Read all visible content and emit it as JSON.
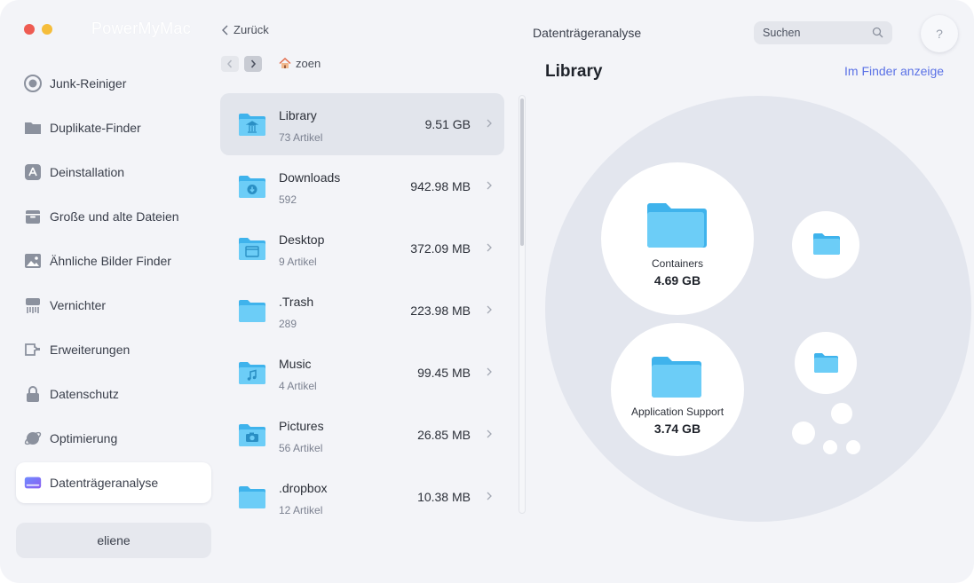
{
  "app": {
    "title": "PowerMyMac"
  },
  "sidebar": {
    "items": [
      {
        "label": "Junk-Reiniger",
        "icon": "junk-cleaner-icon"
      },
      {
        "label": "Duplikate-Finder",
        "icon": "duplicate-folder-icon"
      },
      {
        "label": "Deinstallation",
        "icon": "uninstall-icon"
      },
      {
        "label": "Große und alte Dateien",
        "icon": "large-files-icon"
      },
      {
        "label": "Ähnliche Bilder Finder",
        "icon": "image-icon"
      },
      {
        "label": "Vernichter",
        "icon": "shredder-icon"
      },
      {
        "label": "Erweiterungen",
        "icon": "extensions-icon"
      },
      {
        "label": "Datenschutz",
        "icon": "lock-icon"
      },
      {
        "label": "Optimierung",
        "icon": "optimization-icon"
      },
      {
        "label": "Datenträgeranalyse",
        "icon": "disk-icon",
        "active": true
      }
    ],
    "user": "eliene"
  },
  "header": {
    "back_label": "Zurück",
    "title": "Datenträgeranalyse",
    "search_placeholder": "Suchen",
    "help_label": "?"
  },
  "path": {
    "current": "zoen"
  },
  "files": [
    {
      "name": "Library",
      "sub": "73 Artikel",
      "size": "9.51 GB",
      "icon": "library-folder-icon",
      "selected": true
    },
    {
      "name": "Downloads",
      "sub": "592",
      "size": "942.98 MB",
      "icon": "downloads-folder-icon"
    },
    {
      "name": "Desktop",
      "sub": "9 Artikel",
      "size": "372.09 MB",
      "icon": "desktop-folder-icon"
    },
    {
      "name": ".Trash",
      "sub": "289",
      "size": "223.98 MB",
      "icon": "folder-icon"
    },
    {
      "name": "Music",
      "sub": "4 Artikel",
      "size": "99.45 MB",
      "icon": "music-folder-icon"
    },
    {
      "name": "Pictures",
      "sub": "56 Artikel",
      "size": "26.85 MB",
      "icon": "pictures-folder-icon"
    },
    {
      "name": ".dropbox",
      "sub": "12 Artikel",
      "size": "10.38 MB",
      "icon": "folder-icon"
    }
  ],
  "detail": {
    "title": "Library",
    "finder_link": "Im Finder anzeige",
    "bubbles": [
      {
        "label": "Containers",
        "size": "4.69 GB"
      },
      {
        "label": "Application Support",
        "size": "3.74 GB"
      }
    ]
  },
  "colors": {
    "accent": "#5b72e6",
    "folder": "#5ac8fa",
    "background": "#f3f4f8"
  }
}
